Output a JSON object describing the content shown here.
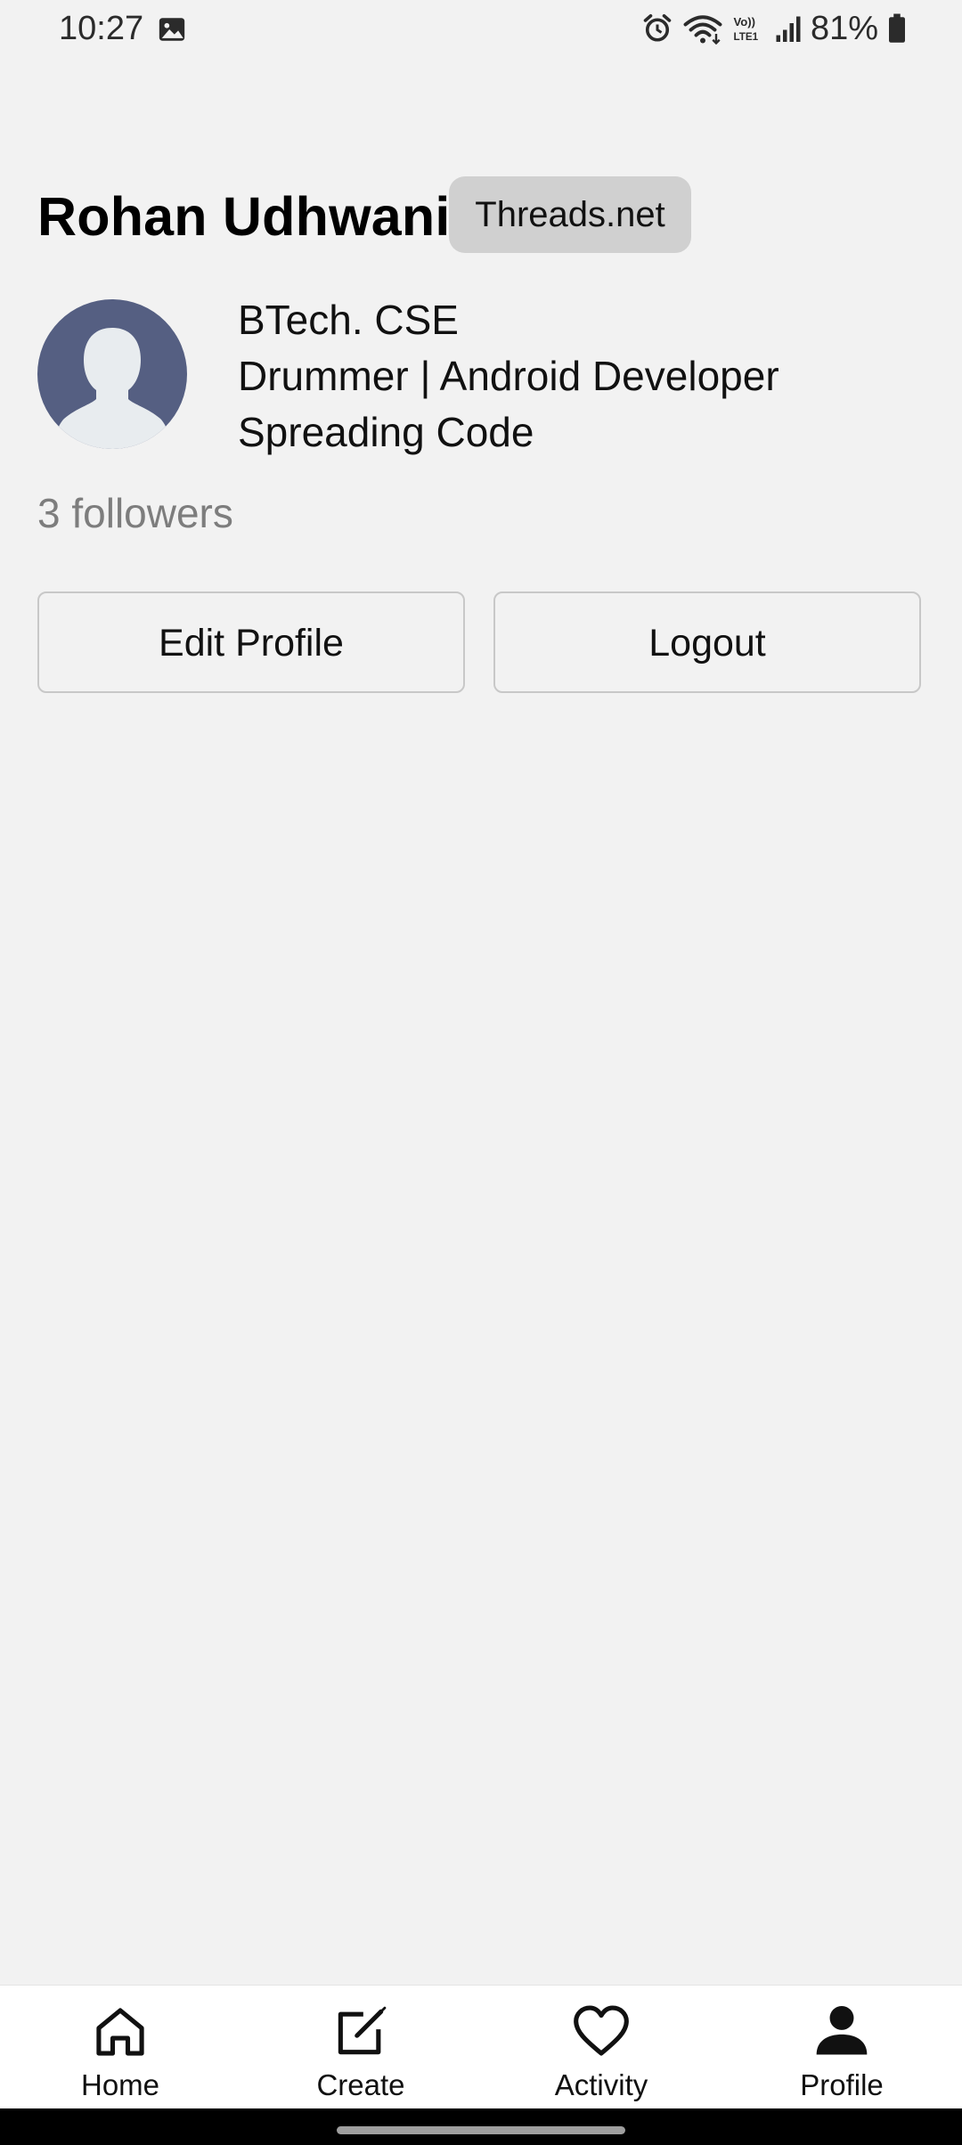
{
  "status_bar": {
    "time": "10:27",
    "battery": "81%",
    "icons": [
      "gallery-icon",
      "alarm-icon",
      "wifi-icon",
      "volte-icon",
      "signal-icon",
      "battery-icon"
    ]
  },
  "profile": {
    "name": "Rohan Udhwani",
    "badge": "Threads.net",
    "bio": [
      "BTech. CSE",
      "Drummer | Android Developer",
      "Spreading Code"
    ],
    "followers": "3 followers",
    "avatar": "default-avatar-icon"
  },
  "actions": {
    "edit_profile": "Edit Profile",
    "logout": "Logout"
  },
  "bottom_nav": {
    "items": [
      {
        "label": "Home",
        "icon": "home-icon"
      },
      {
        "label": "Create",
        "icon": "create-icon"
      },
      {
        "label": "Activity",
        "icon": "heart-icon"
      },
      {
        "label": "Profile",
        "icon": "person-icon"
      }
    ],
    "active": "Profile"
  },
  "colors": {
    "background": "#f2f2f2",
    "badge_bg": "#d0d0d0",
    "avatar_bg": "#555f82",
    "avatar_figure": "#e8ecef",
    "followers_text": "#7d7d7d",
    "nav_bg": "#ffffff"
  }
}
